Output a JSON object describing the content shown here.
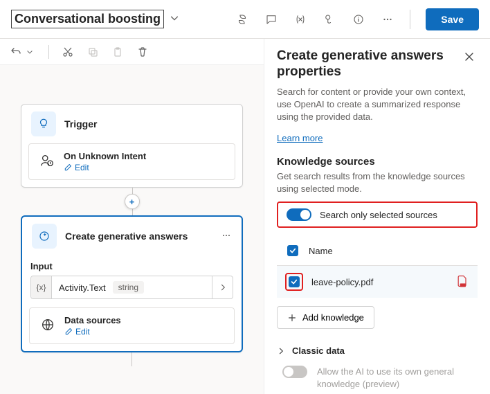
{
  "header": {
    "title": "Conversational boosting",
    "save_label": "Save"
  },
  "canvas": {
    "trigger_title": "Trigger",
    "trigger_sub_title": "On Unknown Intent",
    "edit_label": "Edit",
    "gen_title": "Create generative answers",
    "input_label": "Input",
    "fx_value": "Activity.Text",
    "fx_type": "string",
    "data_sources_label": "Data sources"
  },
  "panel": {
    "title": "Create generative answers properties",
    "desc": "Search for content or provide your own context, use OpenAI to create a summarized response using the provided data.",
    "learn_more": "Learn more",
    "ks_heading": "Knowledge sources",
    "ks_sub": "Get search results from the knowledge sources using selected mode.",
    "toggle_label": "Search only selected sources",
    "name_col": "Name",
    "file_name": "leave-policy.pdf",
    "add_label": "Add knowledge",
    "classic_label": "Classic data",
    "allow_label": "Allow the AI to use its own general knowledge (preview)"
  }
}
